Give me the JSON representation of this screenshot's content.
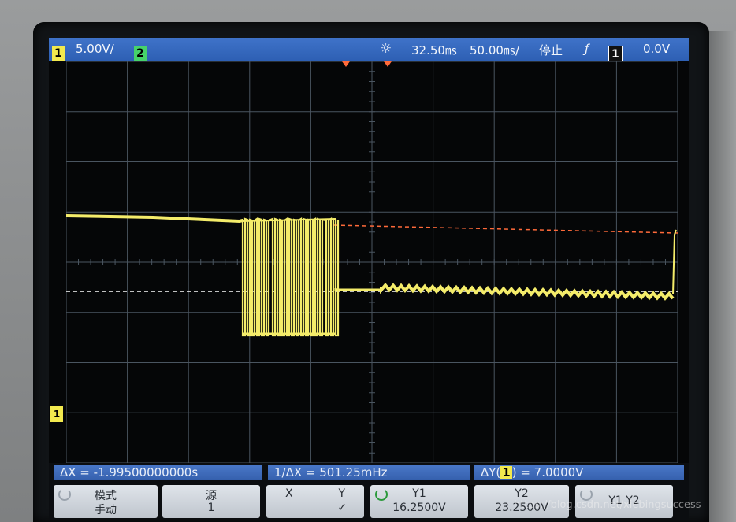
{
  "topbar": {
    "ch1_num": "1",
    "ch1_scale": "5.00V/",
    "ch2_num": "2",
    "time_position": "32.50㎳",
    "time_scale": "50.00㎳/",
    "run_state": "停止",
    "trigger_edge": "ƒ",
    "trigger_ch": "1",
    "trigger_level": "0.0V"
  },
  "ground_marker": "1",
  "readout": {
    "delta_x": "ΔX = -1.99500000000s",
    "inv_delta_x": "1/ΔX = 501.25mHz",
    "delta_y_prefix": "ΔY(",
    "delta_y_ch": "1",
    "delta_y_suffix": ") = 7.0000V"
  },
  "softkeys": [
    {
      "line1": "模式",
      "line2": "手动"
    },
    {
      "line1": "源",
      "line2": "1"
    },
    {
      "line1": "X",
      "line2": "Y",
      "line3": "✓"
    },
    {
      "line1": "Y1",
      "line2": "16.2500V"
    },
    {
      "line1": "Y2",
      "line2": "23.2500V"
    },
    {
      "line1": "Y1 Y2"
    }
  ],
  "watermark": "https://blog.csdn.net/xiebingsuccess",
  "colors": {
    "trace": "#f4ec6a",
    "cursor_y1": "#ffffff",
    "cursor_y2": "#ff6a3a",
    "grid": "#4a5560"
  }
}
